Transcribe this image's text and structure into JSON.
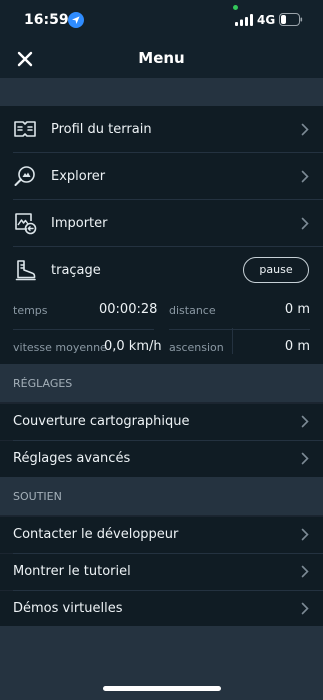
{
  "status_bar": {
    "time": "16:59",
    "network": "4G",
    "icons": [
      "location-arrow-icon",
      "signal-icon",
      "battery-icon"
    ]
  },
  "header": {
    "title": "Menu",
    "close_icon": "close-icon"
  },
  "menu": {
    "items": [
      {
        "label": "Profil du terrain",
        "icon": "terrain-profile-icon"
      },
      {
        "label": "Explorer",
        "icon": "explore-icon"
      },
      {
        "label": "Importer",
        "icon": "import-icon"
      }
    ],
    "tracking": {
      "label": "traçage",
      "icon": "boot-icon",
      "pause_label": "pause"
    }
  },
  "stats": {
    "time_label": "temps",
    "time_value": "00:00:28",
    "distance_label": "distance",
    "distance_value": "0 m",
    "speed_label": "vitesse moyenne",
    "speed_value": "0,0 km/h",
    "ascent_label": "ascension",
    "ascent_value": "0 m"
  },
  "settings": {
    "title": "RÉGLAGES",
    "items": [
      "Couverture cartographique",
      "Réglages avancés"
    ]
  },
  "support": {
    "title": "SOUTIEN",
    "items": [
      "Contacter le développeur",
      "Montrer le tutoriel",
      "Démos virtuelles"
    ]
  },
  "colors": {
    "background": "#1b2530",
    "panel": "#101c24",
    "section": "#253340",
    "status_green": "#33c75a"
  }
}
